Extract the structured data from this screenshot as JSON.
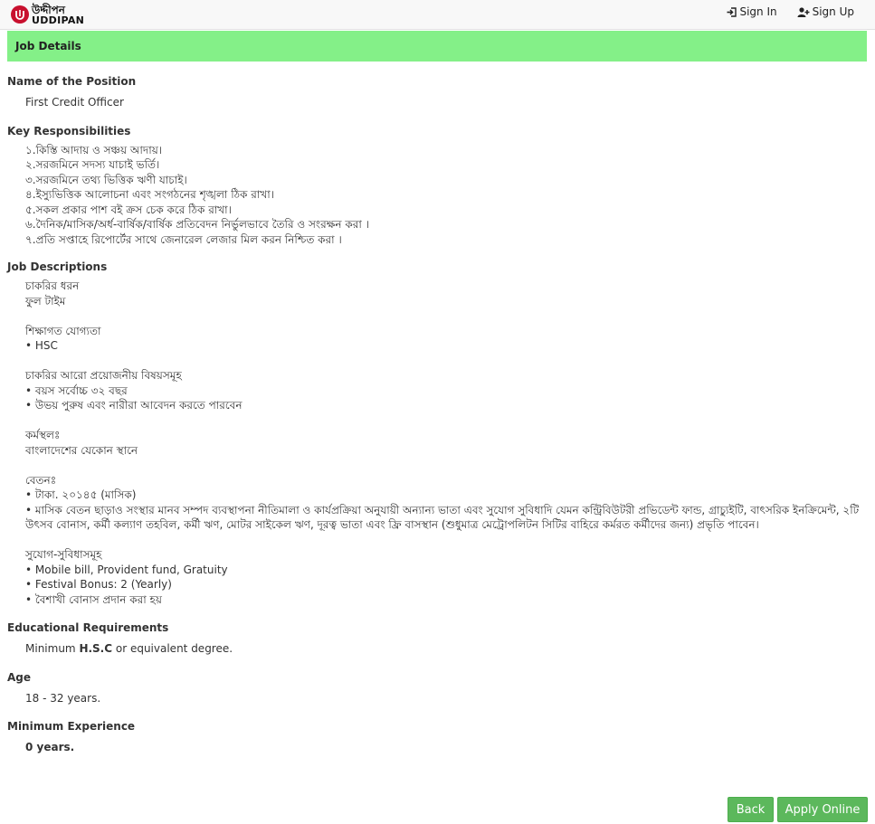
{
  "header": {
    "logo_bn": "উদ্দীপন",
    "logo_en": "UDDIPAN",
    "nav": {
      "sign_in": "Sign In",
      "sign_up": "Sign Up"
    }
  },
  "panel": {
    "title": "Job Details"
  },
  "position": {
    "heading": "Name of the Position",
    "value": "First Credit Officer"
  },
  "responsibilities": {
    "heading": "Key Responsibilities",
    "items": [
      "১.কিস্তি আদায় ও সঞ্চয় আদায়।",
      "২.সরজমিনে সদস্য যাচাই ভর্তি।",
      "৩.সরজমিনে তথ্য ভিত্তিক ঋণী যাচাই।",
      "৪.ইস্যুভিত্তিক আলোচনা এবং সংগঠনের শৃঙ্খলা ঠিক রাখা।",
      "৫.সকল প্রকার পাশ বই ক্রস চেক করে ঠিক রাখা।",
      "৬.দৈনিক/মাসিক/অর্ধ-বার্ষিক/বার্ষিক প্রতিবেদন নির্ভুলভাবে তৈরি ও সংরক্ষন করা ।",
      "৭.প্রতি সপ্তাহে রিপোর্টের সাথে জেনারেল লেজার মিল করন নিশ্চিত করা ।"
    ]
  },
  "descriptions": {
    "heading": "Job Descriptions",
    "job_type_label": "চাকরির ধরন",
    "job_type_value": "ফুল টাইম",
    "edu_label": "শিক্ষাগত যোগ্যতা",
    "edu_item": "• HSC",
    "other_label": "চাকরির আরো প্রয়োজনীয় বিষয়সমূহ",
    "other_items": [
      "• বয়স সর্বোচ্চ ৩২ বছর",
      "• উভয় পুরুষ এবং নারীরা আবেদন করতে পারবেন"
    ],
    "location_label": "কর্মস্থলঃ",
    "location_value": "বাংলাদেশের যেকোন স্থানে",
    "salary_label": "বেতনঃ",
    "salary_items": [
      "• টাকা. ২০১৪৫ (মাসিক)",
      "• মাসিক বেতন ছাড়াও সংস্থার মানব সম্পদ ব্যবস্থাপনা নীতিমালা ও কার্যপ্রক্রিয়া অনুযায়ী অন্যান্য ভাতা এবং সুযোগ সুবিধাদি যেমন কন্ট্রিবিউটরী প্রভিডেন্ট ফান্ড, গ্রাচ্যুইটি, বাৎসরিক ইনক্রিমেন্ট, ২টি উৎসব বোনাস, কর্মী কল্যাণ তহবিল, কর্মী ঋণ, মোটর সাইকেল ঋণ, দূরত্ব ভাতা এবং ফ্রি বাসস্থান (শুধুমাত্র মেট্রোপলিটন সিটির বাহিরে কর্মরত কর্মীদের জন্য) প্রভৃতি পাবেন।"
    ],
    "benefits_label": "সুযোগ-সুবিধাসমূহ",
    "benefits_items": [
      "• Mobile bill, Provident fund, Gratuity",
      "• Festival Bonus: 2 (Yearly)",
      "• বৈশাখী বোনাস প্রদান করা হয়"
    ]
  },
  "education": {
    "heading": "Educational Requirements",
    "prefix": "Minimum ",
    "bold": "H.S.C",
    "suffix": " or equivalent degree."
  },
  "age": {
    "heading": "Age",
    "value": "18 - 32 years."
  },
  "experience": {
    "heading": "Minimum Experience",
    "value": "0 years."
  },
  "buttons": {
    "back": "Back",
    "apply": "Apply Online"
  },
  "colors": {
    "header_bg": "#84f088",
    "button_bg": "#5cb85c",
    "logo_red": "#c8102e"
  }
}
